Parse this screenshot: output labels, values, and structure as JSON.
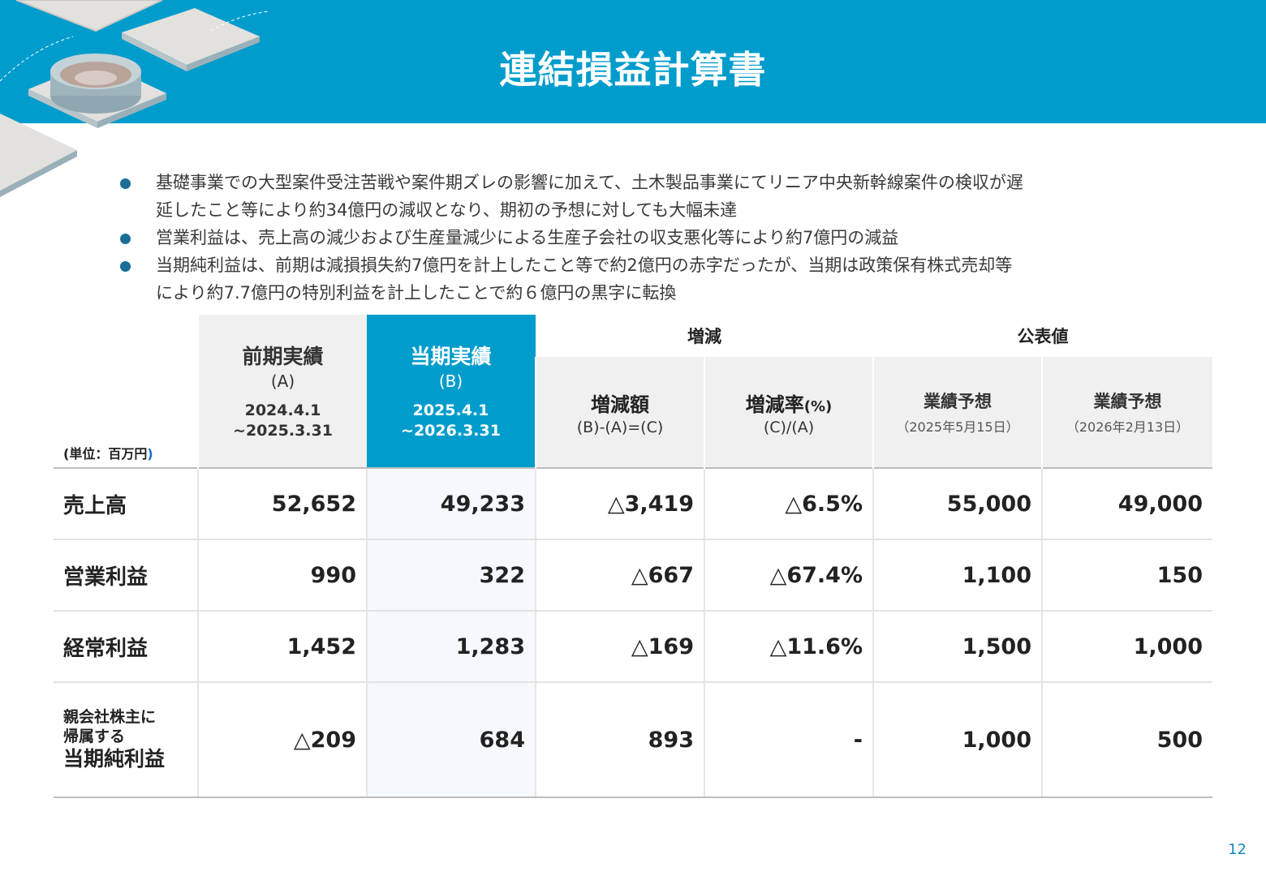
{
  "header": {
    "title": "連結損益計算書"
  },
  "bullets": [
    {
      "line1": "基礎事業での大型案件受注苦戦や案件期ズレの影響に加えて、土木製品事業にてリニア中央新幹線案件の検収が遅",
      "line2": "延したこと等により約34億円の減収となり、期初の予想に対しても大幅未達"
    },
    {
      "line1": "営業利益は、売上高の減少および生産量減少による生産子会社の収支悪化等により約7億円の減益",
      "line2": ""
    },
    {
      "line1": "当期純利益は、前期は減損損失約7億円を計上したこと等で約2億円の赤字だったが、当期は政策保有株式売却等",
      "line2": "により約7.7億円の特別利益を計上したことで約６億円の黒字に転換"
    }
  ],
  "table": {
    "unit_label": "(単位：百万円",
    "unit_paren": ")",
    "prev": {
      "title": "前期実績",
      "sub": "(A)",
      "date1": "2024.4.1",
      "date2": "~2025.3.31"
    },
    "cur": {
      "title": "当期実績",
      "sub": "(B)",
      "date1": "2025.4.1",
      "date2": "~2026.3.31"
    },
    "group_change": "増減",
    "group_public": "公表値",
    "col_change_amt": {
      "title": "増減額",
      "sub": "(B)-(A)=(C)"
    },
    "col_change_rate": {
      "title": "増減率",
      "unit": "(%)",
      "sub": "(C)/(A)"
    },
    "col_forecast1": {
      "title": "業績予想",
      "sub": "（2025年5月15日）"
    },
    "col_forecast2": {
      "title": "業績予想",
      "sub": "（2026年2月13日）"
    },
    "rows": [
      {
        "label": "売上高",
        "prev": "52,652",
        "cur": "49,233",
        "amt": "△3,419",
        "rate": "△6.5%",
        "f1": "55,000",
        "f2": "49,000"
      },
      {
        "label": "営業利益",
        "prev": "990",
        "cur": "322",
        "amt": "△667",
        "rate": "△67.4%",
        "f1": "1,100",
        "f2": "150"
      },
      {
        "label": "経常利益",
        "prev": "1,452",
        "cur": "1,283",
        "amt": "△169",
        "rate": "△11.6%",
        "f1": "1,500",
        "f2": "1,000"
      },
      {
        "label_line1": "親会社株主に",
        "label_line2": "帰属する",
        "label_line3": "当期純利益",
        "prev": "△209",
        "cur": "684",
        "amt": "893",
        "rate": "-",
        "f1": "1,000",
        "f2": "500"
      }
    ]
  },
  "page_number": "12"
}
